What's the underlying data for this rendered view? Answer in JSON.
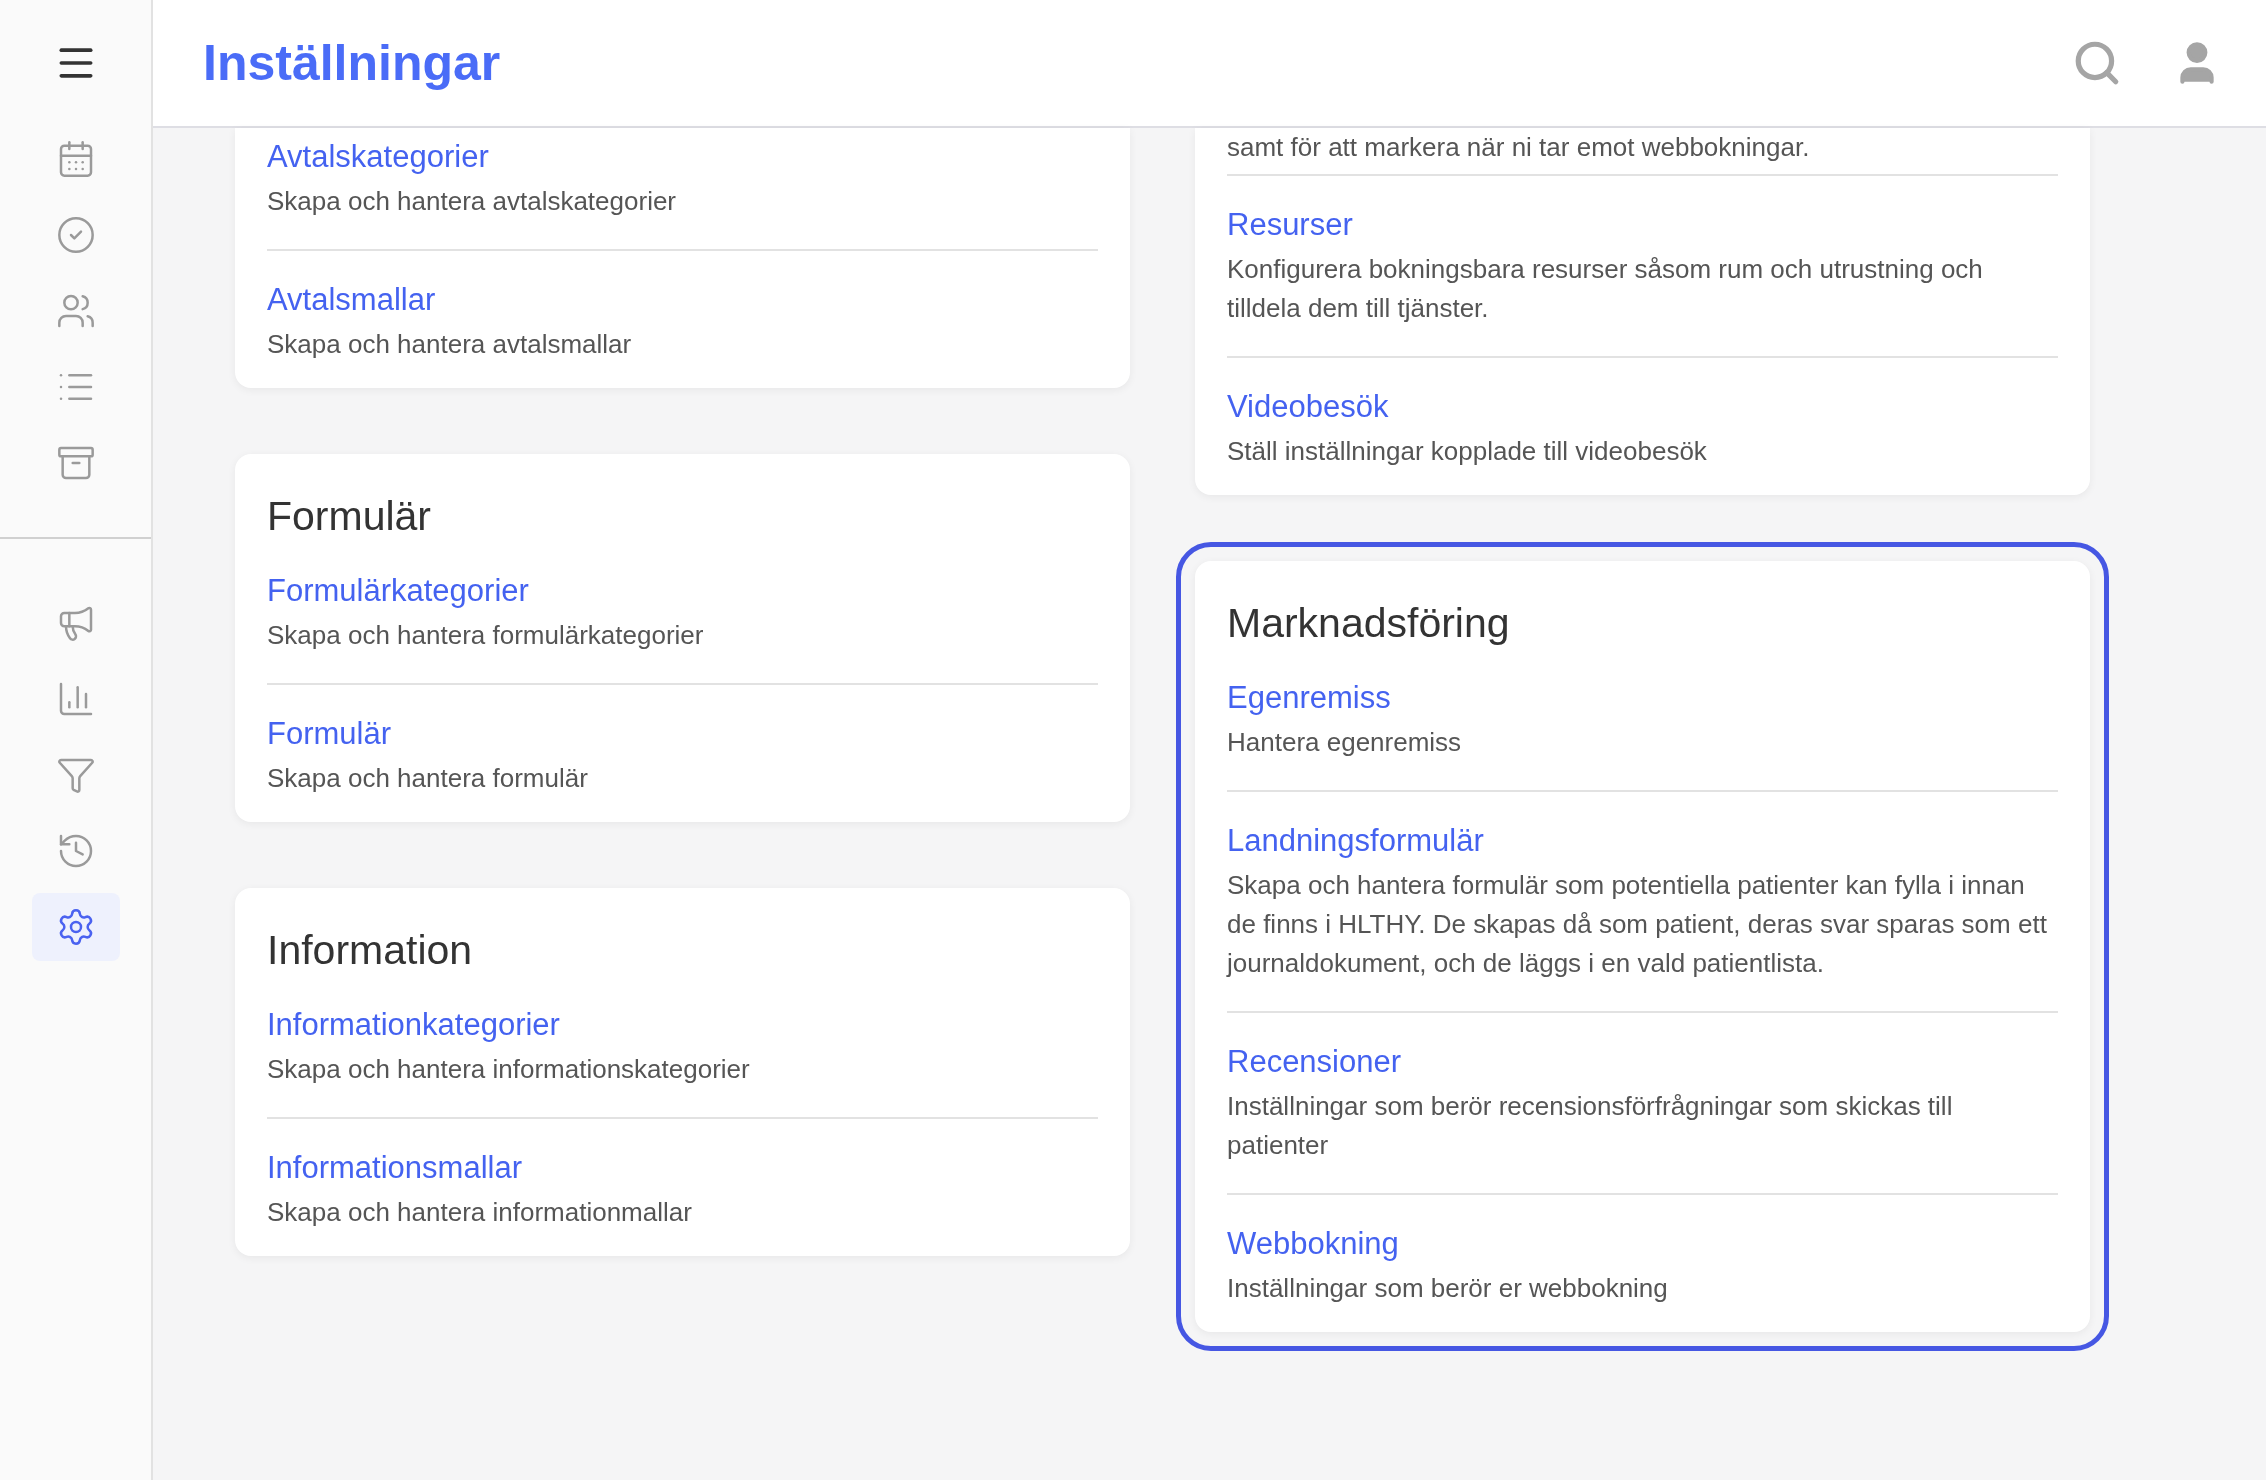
{
  "header": {
    "title": "Inställningar"
  },
  "sidebar": {
    "groups": [
      {
        "items": [
          {
            "kind": "calendar",
            "selected": false
          },
          {
            "kind": "check",
            "selected": false
          },
          {
            "kind": "people",
            "selected": false
          },
          {
            "kind": "list",
            "selected": false
          },
          {
            "kind": "archive",
            "selected": false
          }
        ]
      },
      {
        "items": [
          {
            "kind": "megaphone",
            "selected": false
          },
          {
            "kind": "chart",
            "selected": false
          },
          {
            "kind": "filter",
            "selected": false
          },
          {
            "kind": "history",
            "selected": false
          },
          {
            "kind": "settings",
            "selected": true
          }
        ]
      }
    ]
  },
  "columns": [
    {
      "cards": [
        {
          "highlighted": false,
          "items": [
            {
              "title": "Avtalskategorier",
              "description": "Skapa och hantera avtalskategorier"
            },
            {
              "title": "Avtalsmallar",
              "description": "Skapa och hantera avtalsmallar"
            }
          ]
        },
        {
          "title": "Formulär",
          "highlighted": false,
          "items": [
            {
              "title": "Formulärkategorier",
              "description": "Skapa och hantera formulärkategorier"
            },
            {
              "title": "Formulär",
              "description": "Skapa och hantera formulär"
            }
          ]
        },
        {
          "title": "Information",
          "highlighted": false,
          "items": [
            {
              "title": "Informationkategorier",
              "description": "Skapa och hantera informationskategorier"
            },
            {
              "title": "Informationsmallar",
              "description": "Skapa och hantera informationmallar"
            }
          ]
        }
      ]
    },
    {
      "cards": [
        {
          "highlighted": false,
          "lead_text": "samt för att markera när ni tar emot webbokningar.",
          "items": [
            {
              "title": "Resurser",
              "description": "Konfigurera bokningsbara resurser såsom rum och utrustning och tilldela dem till tjänster."
            },
            {
              "title": "Videobesök",
              "description": "Ställ inställningar kopplade till videobesök"
            }
          ]
        },
        {
          "title": "Marknadsföring",
          "highlighted": true,
          "items": [
            {
              "title": "Egenremiss",
              "description": "Hantera egenremiss"
            },
            {
              "title": "Landningsformulär",
              "description": "Skapa och hantera formulär som potentiella patienter kan fylla i innan de finns i HLTHY. De skapas då som patient, deras svar sparas som ett journaldokument, och de läggs i en vald patientlista."
            },
            {
              "title": "Recensioner",
              "description": "Inställningar som berör recensionsförfrågningar som skickas till patienter"
            },
            {
              "title": "Webbokning",
              "description": "Inställningar som berör er webbokning"
            }
          ]
        }
      ]
    }
  ]
}
